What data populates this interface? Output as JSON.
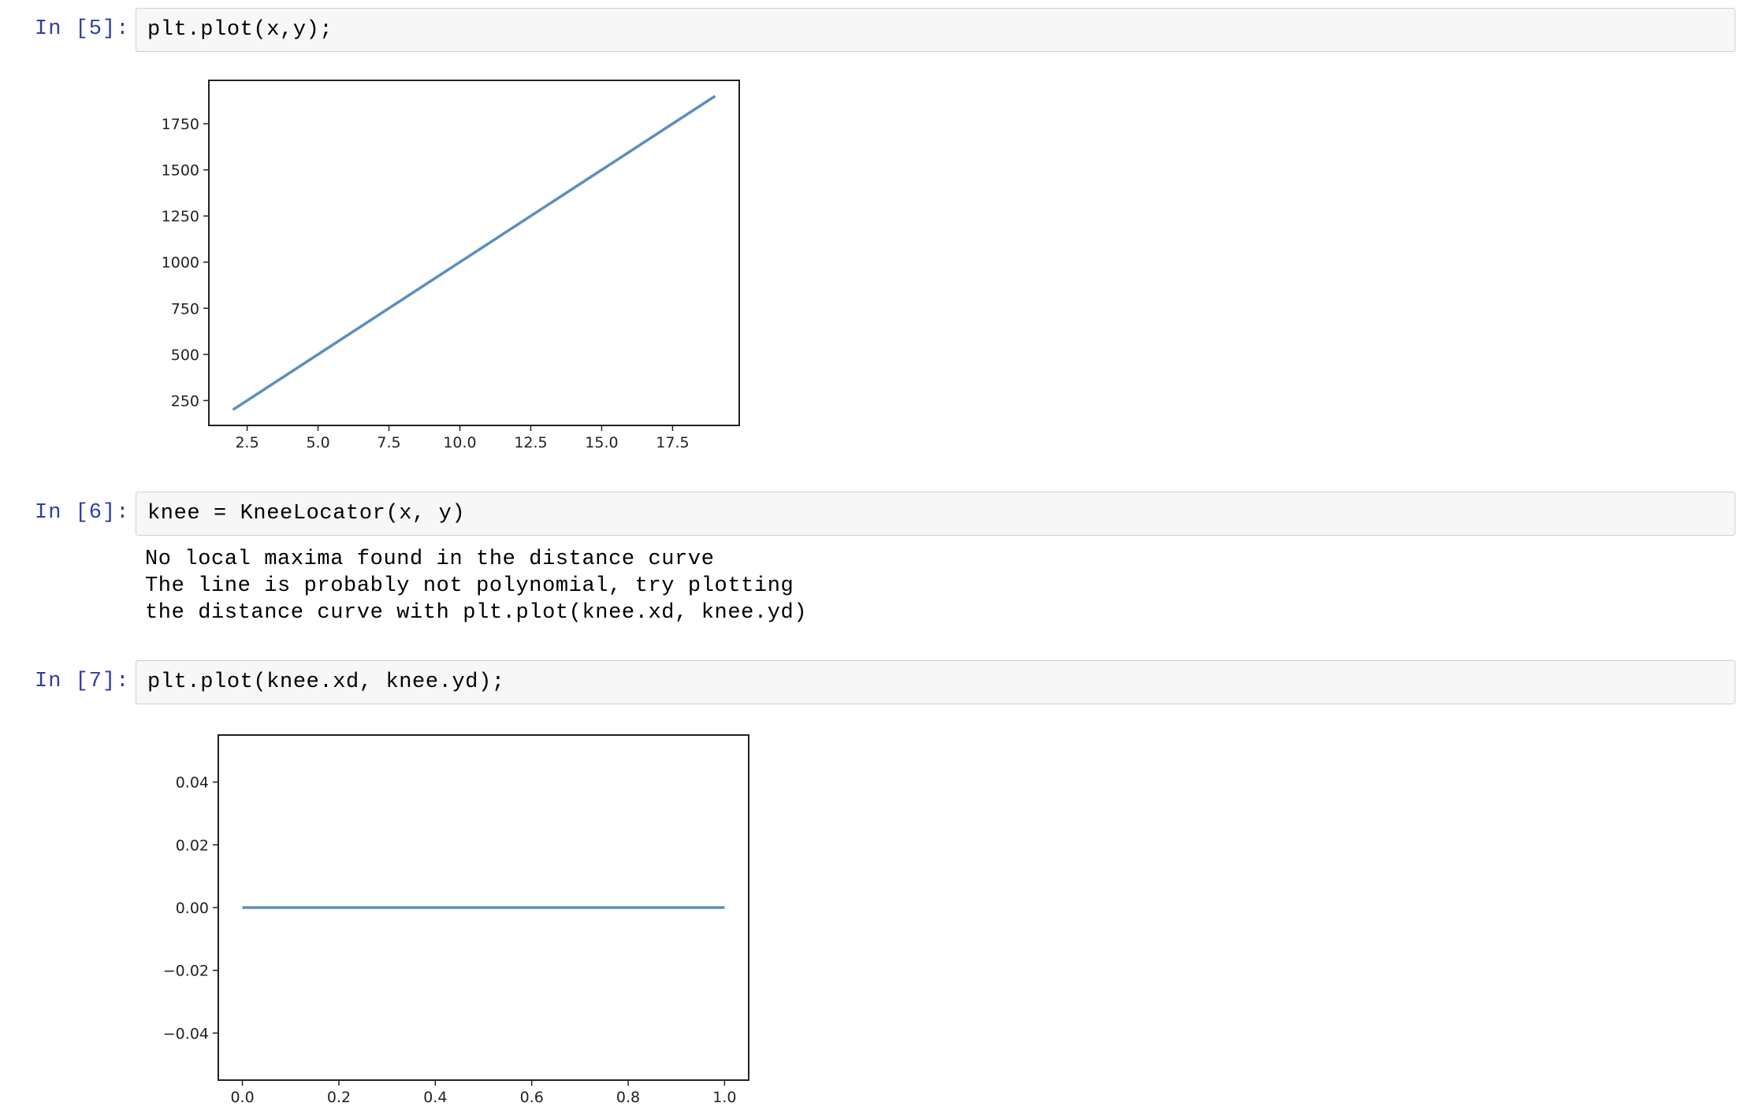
{
  "cells": [
    {
      "prompt": "In [5]:",
      "code": "plt.plot(x,y);"
    },
    {
      "prompt": "In [6]:",
      "code": "knee = KneeLocator(x, y)",
      "output_lines": [
        "No local maxima found in the distance curve",
        "The line is probably not polynomial, try plotting",
        "the distance curve with plt.plot(knee.xd, knee.yd)"
      ]
    },
    {
      "prompt": "In [7]:",
      "code": "plt.plot(knee.xd, knee.yd);"
    }
  ],
  "chart_data": [
    {
      "type": "line",
      "title": "",
      "xlabel": "",
      "ylabel": "",
      "xlim": [
        1.15,
        19.85
      ],
      "ylim": [
        115,
        1985
      ],
      "xticks": [
        2.5,
        5.0,
        7.5,
        10.0,
        12.5,
        15.0,
        17.5
      ],
      "xtick_labels": [
        "2.5",
        "5.0",
        "7.5",
        "10.0",
        "12.5",
        "15.0",
        "17.5"
      ],
      "yticks": [
        250,
        500,
        750,
        1000,
        1250,
        1500,
        1750
      ],
      "ytick_labels": [
        "250",
        "500",
        "750",
        "1000",
        "1250",
        "1500",
        "1750"
      ],
      "series": [
        {
          "x": [
            2,
            19
          ],
          "y": [
            200,
            1900
          ],
          "color": "#5b8fbf"
        }
      ],
      "grid": false
    },
    {
      "type": "line",
      "title": "",
      "xlabel": "",
      "ylabel": "",
      "xlim": [
        -0.05,
        1.05
      ],
      "ylim": [
        -0.055,
        0.055
      ],
      "xticks": [
        0.0,
        0.2,
        0.4,
        0.6,
        0.8,
        1.0
      ],
      "xtick_labels": [
        "0.0",
        "0.2",
        "0.4",
        "0.6",
        "0.8",
        "1.0"
      ],
      "yticks": [
        -0.04,
        -0.02,
        0.0,
        0.02,
        0.04
      ],
      "ytick_labels": [
        "−0.04",
        "−0.02",
        "0.00",
        "0.02",
        "0.04"
      ],
      "series": [
        {
          "x": [
            0.0,
            1.0
          ],
          "y": [
            0.0,
            0.0
          ],
          "color": "#5b8fbf"
        }
      ],
      "grid": false
    }
  ]
}
